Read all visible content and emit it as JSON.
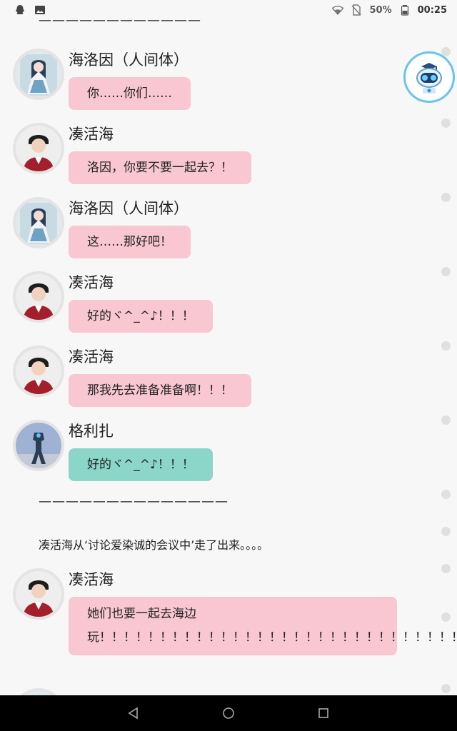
{
  "status_bar": {
    "battery_percent": "50%",
    "time": "00:25"
  },
  "chat": {
    "divider_top": "————————————",
    "divider_mid": "——————————————",
    "narration": "凑活海从‘讨论爱染诚的会议中’走了出来。。。。",
    "messages": [
      {
        "name": "海洛因（人间体）",
        "text": "你……你们……",
        "color": "#f8c7d2"
      },
      {
        "name": "凑活海",
        "text": "洛因，你要不要一起去？！",
        "color": "#f8c7d2"
      },
      {
        "name": "海洛因（人间体）",
        "text": "这……那好吧！",
        "color": "#f8c7d2"
      },
      {
        "name": "凑活海",
        "text": "好的ヾ^_^♪！！！",
        "color": "#f8c7d2"
      },
      {
        "name": "凑活海",
        "text": "那我先去准备准备啊！！！",
        "color": "#f8c7d2"
      },
      {
        "name": "格利扎",
        "text": "好的ヾ^_^♪！！！",
        "color": "#8bd5c9"
      },
      {
        "name": "凑活海",
        "text": "她们也要一起去海边玩！！！！！！！！！！！！！！！！！！！！！！！！！！！！！！！！！！！！！！！！！",
        "color": "#f8c7d2"
      }
    ]
  },
  "colors": {
    "bubble_pink": "#f8c7d2",
    "bubble_teal": "#8bd5c9",
    "background": "#f7f7f7",
    "navbar": "#000000"
  },
  "icons": {
    "status_left": [
      "notification-qq-icon",
      "image-icon"
    ],
    "status_right": [
      "wifi-icon",
      "no-sim-icon",
      "battery-icon"
    ],
    "nav": [
      "back-icon",
      "home-icon",
      "recents-icon"
    ],
    "floating": "robot-assistant-icon"
  }
}
